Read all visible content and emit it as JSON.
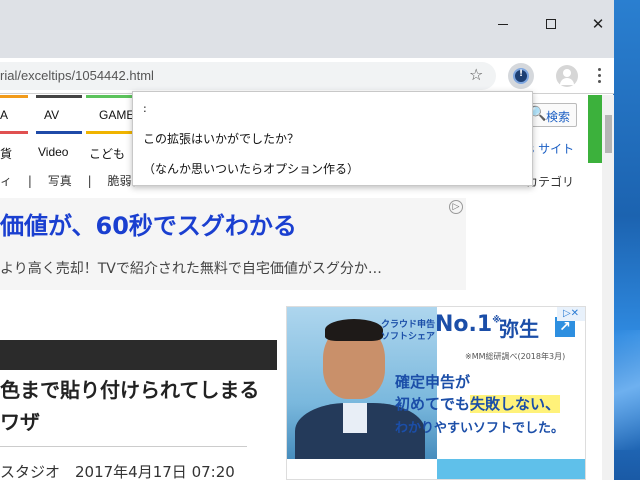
{
  "browser": {
    "url": "rial/exceltips/1054442.html",
    "window_controls": {
      "minimize": "",
      "maximize": "",
      "close": "✕"
    }
  },
  "nav": {
    "row1": [
      "A",
      "AV",
      "GAME"
    ],
    "row2": [
      "貨",
      "Video",
      "こども"
    ],
    "search_label": "検索",
    "site_link": "s サイト",
    "category_link": "カテゴリ",
    "subnav": [
      "ィ",
      "|",
      "写真",
      "|",
      "脆弱性"
    ]
  },
  "ad": {
    "headline": "価値が、60秒でスグわかる",
    "description": "より高く売却！TVで紹介された無料で自宅価値がスグ分か…"
  },
  "article": {
    "title": "色まで貼り付けられてしまるワザ",
    "meta": "スタジオ　2017年4月17日 07:20"
  },
  "banner": {
    "line1": "クラウド申告",
    "line2": "ソフトシェア",
    "no1": "No.1",
    "no1_mark": "※",
    "brand": "弥生",
    "note": "※MM総研調べ(2018年3月)",
    "copy1": "確定申告が",
    "copy2a": "初めてでも",
    "copy2b": "失敗しない、",
    "copy3": "わかりやすいソフトでした。",
    "ad_mark": "▷✕"
  },
  "popup": {
    "colon": ":",
    "question": "この拡張はいかがでしたか？",
    "hint": "（なんか思いついたらオプション作る）"
  },
  "colors": {
    "link_blue": "#1b5fc4",
    "ad_headline": "#1a3fd0",
    "green_bar": "#3cb13c"
  }
}
